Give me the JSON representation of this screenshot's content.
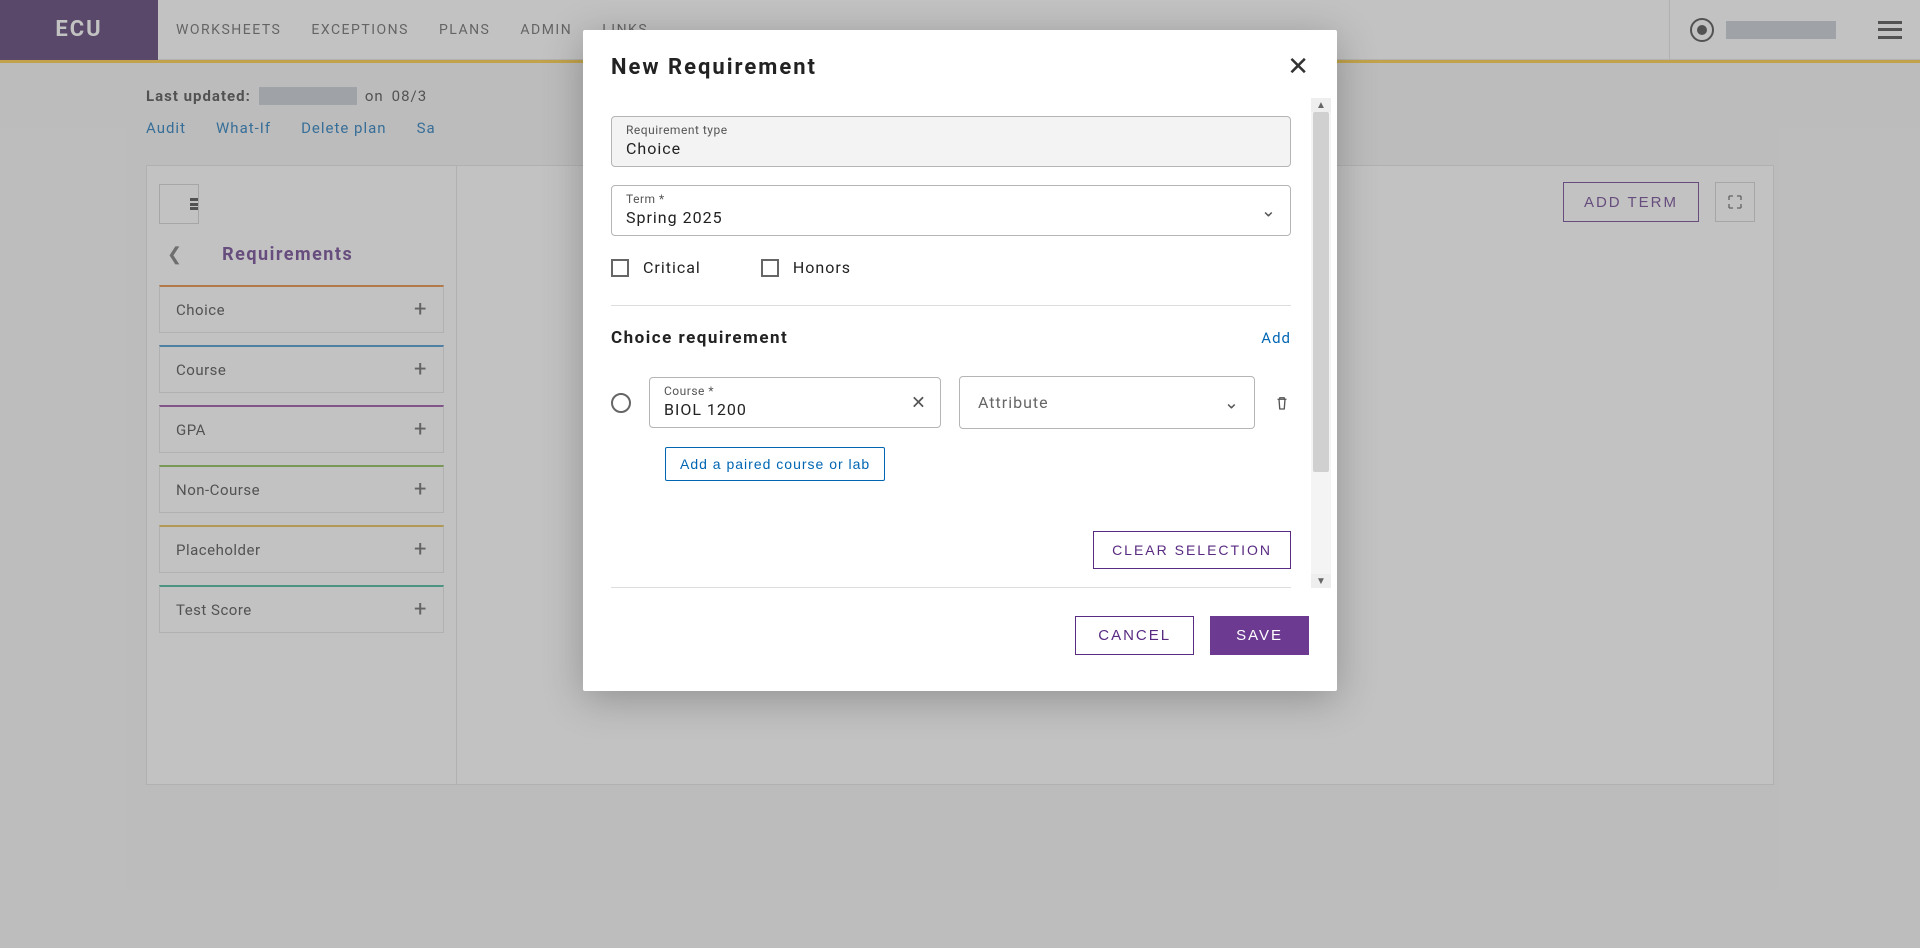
{
  "topbar": {
    "logo_text": "ECU",
    "nav": [
      "WORKSHEETS",
      "EXCEPTIONS",
      "PLANS",
      "ADMIN",
      "LINKS"
    ]
  },
  "meta": {
    "last_updated_label": "Last updated:",
    "on_label": "on",
    "date_fragment": "08/3"
  },
  "links": {
    "audit": "Audit",
    "whatif": "What-If",
    "delete": "Delete plan",
    "save_partial": "Sa"
  },
  "panel": {
    "add_term": "ADD TERM",
    "requirements_title": "Requirements",
    "items": [
      {
        "label": "Choice",
        "color": "#e27a26"
      },
      {
        "label": "Course",
        "color": "#2e86c7"
      },
      {
        "label": "GPA",
        "color": "#8a3a9a"
      },
      {
        "label": "Non-Course",
        "color": "#7ab23f"
      },
      {
        "label": "Placeholder",
        "color": "#e0b43a"
      },
      {
        "label": "Test Score",
        "color": "#2aa98a"
      }
    ]
  },
  "modal": {
    "title": "New Requirement",
    "req_type_label": "Requirement type",
    "req_type_value": "Choice",
    "term_label": "Term *",
    "term_value": "Spring 2025",
    "critical_label": "Critical",
    "honors_label": "Honors",
    "section_title": "Choice requirement",
    "add_label": "Add",
    "course_label": "Course *",
    "course_value": "BIOL 1200",
    "attribute_placeholder": "Attribute",
    "paired_btn": "Add a paired course or lab",
    "clear_selection": "CLEAR SELECTION",
    "cancel": "CANCEL",
    "save": "SAVE"
  }
}
